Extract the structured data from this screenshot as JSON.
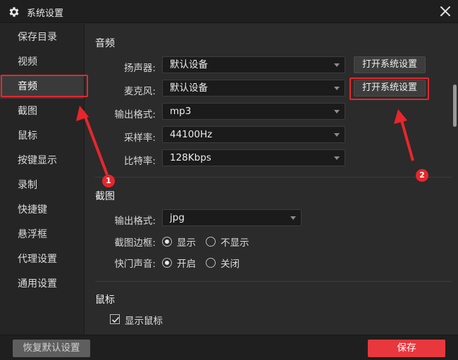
{
  "window": {
    "title": "系统设置",
    "icon": "gear-icon",
    "close_icon": "close-icon"
  },
  "sidebar": {
    "items": [
      {
        "label": "保存目录"
      },
      {
        "label": "视频"
      },
      {
        "label": "音频",
        "active": true
      },
      {
        "label": "截图"
      },
      {
        "label": "鼠标"
      },
      {
        "label": "按键显示"
      },
      {
        "label": "录制"
      },
      {
        "label": "快捷键"
      },
      {
        "label": "悬浮框"
      },
      {
        "label": "代理设置"
      },
      {
        "label": "通用设置"
      }
    ]
  },
  "audio": {
    "title": "音频",
    "speaker": {
      "label": "扬声器:",
      "value": "默认设备",
      "button": "打开系统设置"
    },
    "mic": {
      "label": "麦克风:",
      "value": "默认设备",
      "button": "打开系统设置"
    },
    "format": {
      "label": "输出格式:",
      "value": "mp3"
    },
    "sample_rate": {
      "label": "采样率:",
      "value": "44100Hz"
    },
    "bitrate": {
      "label": "比特率:",
      "value": "128Kbps"
    }
  },
  "screenshot": {
    "title": "截图",
    "format": {
      "label": "输出格式:",
      "value": "jpg"
    },
    "border": {
      "label": "截图边框:",
      "options": [
        "显示",
        "不显示"
      ],
      "selected": 0
    },
    "shutter": {
      "label": "快门声音:",
      "options": [
        "开启",
        "关闭"
      ],
      "selected": 0
    }
  },
  "mouse": {
    "title": "鼠标",
    "show_cursor": {
      "label": "显示鼠标",
      "checked": true
    }
  },
  "footer": {
    "reset_label": "恢复默认设置",
    "save_label": "保存"
  },
  "annotations": {
    "badge_1": "1",
    "badge_2": "2"
  },
  "colors": {
    "accent": "#e8383d",
    "annotation": "#e8262c",
    "background": "#2b2b2b"
  }
}
